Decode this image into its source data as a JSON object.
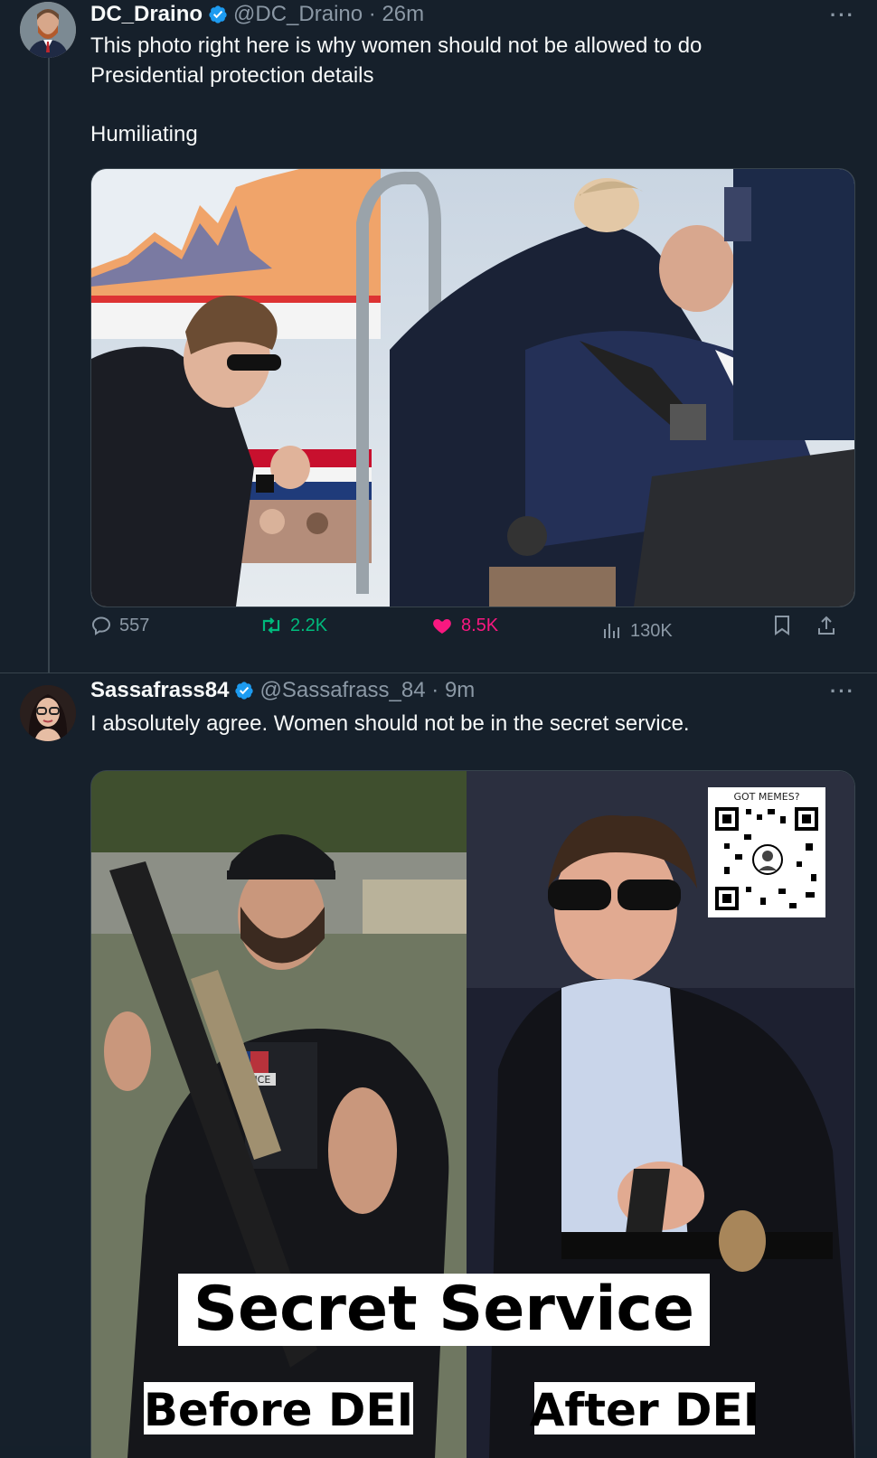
{
  "tweet1": {
    "author_name": "DC_Draino",
    "handle": "@DC_Draino",
    "separator": "·",
    "time": "26m",
    "more": "···",
    "text_line1": "This photo right here is why women should not be allowed to do",
    "text_line2": "Presidential protection details",
    "text_line3": "Humiliating",
    "actions": {
      "replies": "557",
      "reposts": "2.2K",
      "likes": "8.5K",
      "views": "130K"
    }
  },
  "tweet2": {
    "author_name": "Sassafrass84",
    "handle": "@Sassafrass_84",
    "separator": "·",
    "time": "9m",
    "more": "···",
    "text": "I absolutely agree. Women should not be in the secret service.",
    "meme": {
      "title": "Secret Service",
      "left_caption": "Before DEI",
      "right_caption": "After DEI",
      "qr_label": "GOT MEMES?",
      "patch_text": "OLICE"
    }
  },
  "colors": {
    "background": "#15202b",
    "text": "#f7f9f9",
    "muted": "#8b98a5",
    "verified": "#1d9bf0",
    "repost_green": "#00ba7c",
    "like_pink": "#f91880"
  }
}
